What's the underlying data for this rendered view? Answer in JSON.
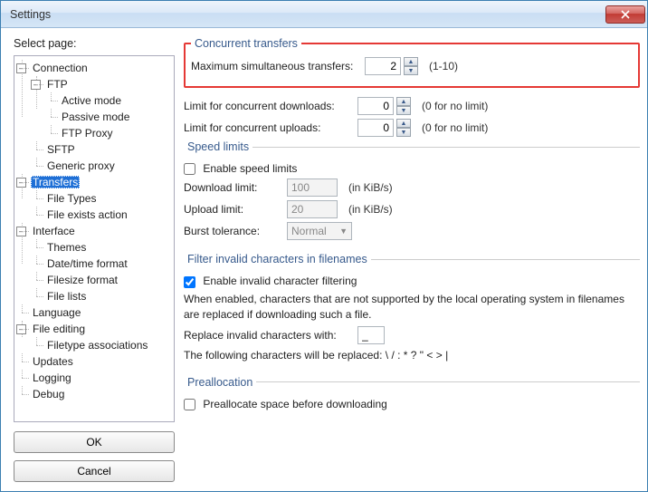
{
  "window": {
    "title": "Settings"
  },
  "left": {
    "select_page": "Select page:",
    "ok": "OK",
    "cancel": "Cancel"
  },
  "tree": {
    "connection": "Connection",
    "ftp": "FTP",
    "active": "Active mode",
    "passive": "Passive mode",
    "ftpproxy": "FTP Proxy",
    "sftp": "SFTP",
    "genericproxy": "Generic proxy",
    "transfers": "Transfers",
    "filetypes": "File Types",
    "fileexists": "File exists action",
    "interface": "Interface",
    "themes": "Themes",
    "dateformat": "Date/time format",
    "filesizeformat": "Filesize format",
    "filelists": "File lists",
    "language": "Language",
    "fileediting": "File editing",
    "filetypeassoc": "Filetype associations",
    "updates": "Updates",
    "logging": "Logging",
    "debug": "Debug"
  },
  "concurrent": {
    "legend": "Concurrent transfers",
    "max_label": "Maximum simultaneous transfers:",
    "max_value": "2",
    "max_hint": "(1-10)",
    "dl_label": "Limit for concurrent downloads:",
    "dl_value": "0",
    "dl_hint": "(0 for no limit)",
    "ul_label": "Limit for concurrent uploads:",
    "ul_value": "0",
    "ul_hint": "(0 for no limit)"
  },
  "speed": {
    "legend": "Speed limits",
    "enable": "Enable speed limits",
    "dl_label": "Download limit:",
    "dl_value": "100",
    "unit": "(in KiB/s)",
    "ul_label": "Upload limit:",
    "ul_value": "20",
    "burst_label": "Burst tolerance:",
    "burst_value": "Normal"
  },
  "filter": {
    "legend": "Filter invalid characters in filenames",
    "enable": "Enable invalid character filtering",
    "desc": "When enabled, characters that are not supported by the local operating system in filenames are replaced if downloading such a file.",
    "replace_label": "Replace invalid characters with:",
    "replace_value": "_",
    "following": "The following characters will be replaced: \\ / : * ? \" < > |"
  },
  "prealloc": {
    "legend": "Preallocation",
    "enable": "Preallocate space before downloading"
  }
}
